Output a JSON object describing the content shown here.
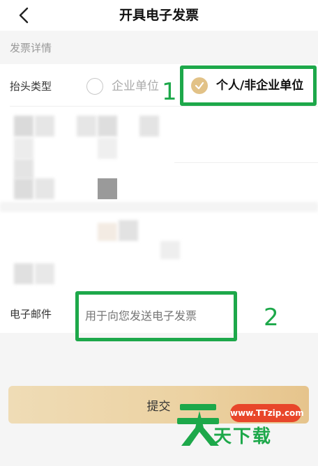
{
  "header": {
    "title": "开具电子发票",
    "back_icon": "chevron-left-icon"
  },
  "section": {
    "label": "发票详情"
  },
  "invoice_type": {
    "label": "抬头类型",
    "options": [
      {
        "label": "企业单位",
        "selected": false
      },
      {
        "label": "个人/非企业单位",
        "selected": true
      }
    ]
  },
  "email": {
    "label": "电子邮件",
    "placeholder": "用于向您发送电子发票",
    "value": ""
  },
  "submit": {
    "label": "提交"
  },
  "annotations": {
    "marker_1": "1",
    "marker_2": "2"
  },
  "watermark": {
    "url": "www.TTzip.com",
    "text": "天下载"
  },
  "colors": {
    "accent": "#e2c287",
    "highlight": "#1da84a",
    "watermark_badge": "#e8462a"
  }
}
